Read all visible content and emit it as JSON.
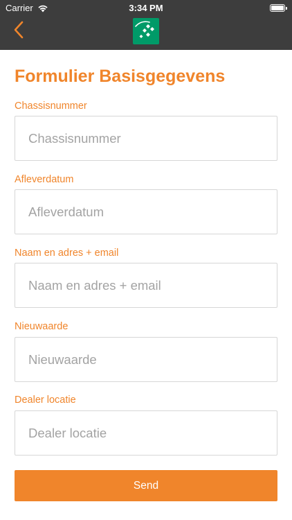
{
  "status_bar": {
    "carrier": "Carrier",
    "time": "3:34 PM",
    "wifi_icon": "wifi-icon",
    "battery_icon": "battery-icon",
    "battery_level": 1.0
  },
  "nav": {
    "back_icon": "chevron-left-icon",
    "logo_icon": "bnp-paribas-stars-logo",
    "accent_color": "#f0852b",
    "bar_color": "#3d3d3d",
    "logo_color": "#009a68"
  },
  "form": {
    "title": "Formulier Basisgegevens",
    "fields": [
      {
        "label": "Chassisnummer",
        "placeholder": "Chassisnummer",
        "value": ""
      },
      {
        "label": "Afleverdatum",
        "placeholder": "Afleverdatum",
        "value": ""
      },
      {
        "label": "Naam en adres + email",
        "placeholder": "Naam en adres + email",
        "value": ""
      },
      {
        "label": "Nieuwaarde",
        "placeholder": "Nieuwaarde",
        "value": ""
      },
      {
        "label": "Dealer locatie",
        "placeholder": "Dealer locatie",
        "value": ""
      }
    ],
    "submit_label": "Send"
  }
}
